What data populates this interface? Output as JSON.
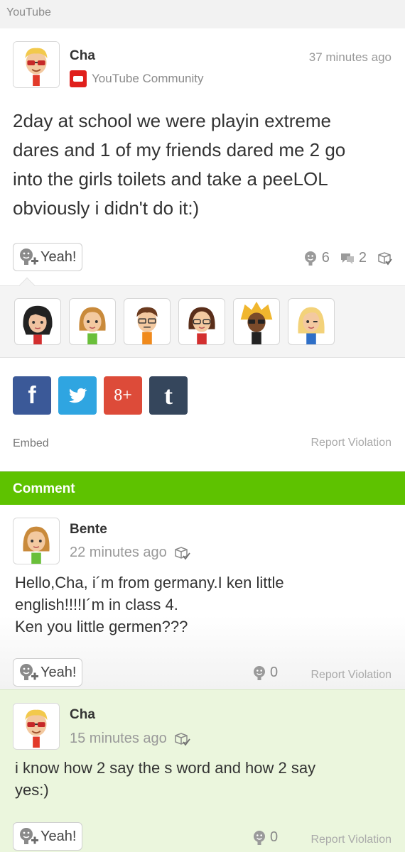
{
  "app": {
    "title": "YouTube"
  },
  "post": {
    "author": "Cha",
    "time": "37 minutes ago",
    "community": "YouTube Community",
    "body_lines": [
      "2day at school we were playin extreme",
      "dares and 1 of my friends dared me 2 go",
      "into the girls toilets and take a peeLOL",
      "obviously i didn't do it:)"
    ],
    "yeah_label": "Yeah!",
    "yeah_count": "6",
    "comment_count": "2"
  },
  "share": {
    "facebook": "f",
    "twitter": "t",
    "google_plus": "8+",
    "tumblr": "t"
  },
  "footer": {
    "embed_label": "Embed",
    "report_label": "Report Violation"
  },
  "comment_bar": {
    "label": "Comment"
  },
  "replies": [
    {
      "author": "Bente",
      "time": "22 minutes ago",
      "body_lines": [
        "Hello,Cha, i´m from germany.I ken little",
        "english!!!!I´m in class 4.",
        "Ken you little germen???"
      ],
      "yeah_label": "Yeah!",
      "yeah_count": "0",
      "report_label": "Report Violation"
    },
    {
      "author": "Cha",
      "time": "15 minutes ago",
      "body_lines": [
        "i know how 2 say the s word and how 2 say",
        "yes:)"
      ],
      "yeah_label": "Yeah!",
      "yeah_count": "0",
      "report_label": "Report Violation"
    }
  ],
  "colors": {
    "comment_bar": "#5ec200",
    "facebook": "#3b5998",
    "twitter": "#2fa5e1",
    "google_plus": "#dd4b39",
    "tumblr": "#35465c",
    "youtube": "#e0201c"
  },
  "icons": [
    "youtube-icon",
    "yeah-add-icon",
    "yeah-face-icon",
    "comment-icon",
    "spoiler-check-icon",
    "facebook-icon",
    "twitter-icon",
    "google-plus-icon",
    "tumblr-icon"
  ]
}
